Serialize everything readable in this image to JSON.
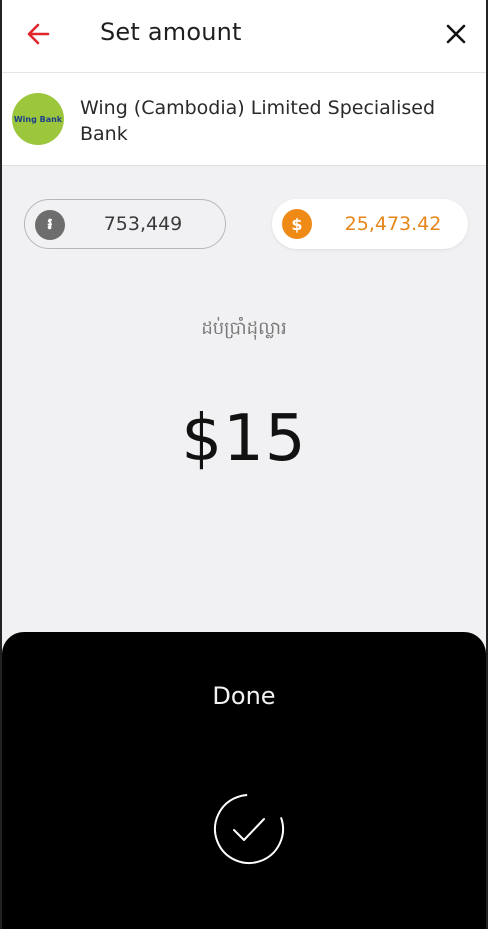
{
  "header": {
    "title": "Set amount",
    "back_icon": "arrow-left-icon",
    "close_icon": "close-icon",
    "accent_color": "#e0242b"
  },
  "bank": {
    "name": "Wing (Cambodia) Limited Specialised Bank",
    "logo_text": "Wing Bank",
    "logo_color": "#9cc63b"
  },
  "balances": {
    "riel": {
      "icon": "riel-coin-icon",
      "symbol": "៛",
      "value": "753,449"
    },
    "usd": {
      "icon": "dollar-coin-icon",
      "symbol": "$",
      "value": "25,473.42",
      "color": "#f08a17"
    }
  },
  "amount": {
    "label": "ដប់ប្រាំដុល្លារ",
    "value": "$15"
  },
  "sheet": {
    "label": "Done",
    "icon": "check-circle-icon"
  }
}
